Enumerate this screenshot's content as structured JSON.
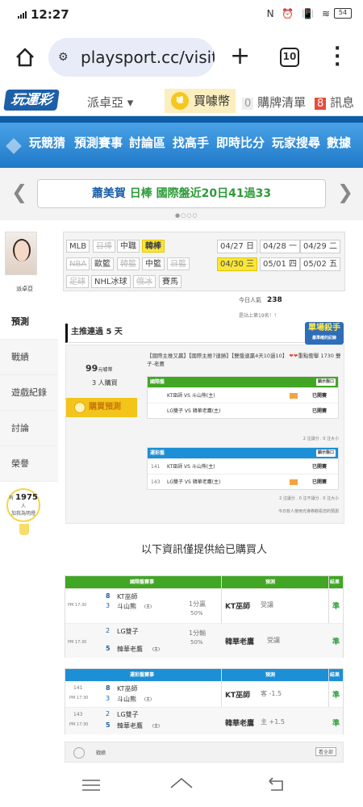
{
  "status": {
    "time": "12:27",
    "icons": "N ⏰ 📳 ≋",
    "battery": "54"
  },
  "browser": {
    "url": "playsport.cc/visit",
    "tab_count": "10"
  },
  "site": {
    "logo": "玩運彩",
    "user": "派卓亞",
    "buy_label": "買噱幣",
    "coin": "噱",
    "cart_count": "0",
    "cart_label": "購牌清單",
    "msg_count": "8",
    "msg_label": "訊息"
  },
  "nav": [
    "玩競猜",
    "預測賽事",
    "討論區",
    "找高手",
    "即時比分",
    "玩家搜尋",
    "數據"
  ],
  "ticker": {
    "name": "蕭美賀",
    "text": "日棒 國際盤近20日41過33",
    "name_color": "#1d5fa8",
    "text_color": "#2e9b3a"
  },
  "profile": {
    "name": "派卓亞",
    "menu": [
      "預測",
      "戰績",
      "遊戲紀錄",
      "討論",
      "榮譽"
    ],
    "fans_label": "有",
    "fans": "1975",
    "fans_unit": "人",
    "fans_sub": "加我為明燈"
  },
  "filters": {
    "leagues": [
      {
        "label": "MLB",
        "state": "normal"
      },
      {
        "label": "日棒",
        "state": "disabled"
      },
      {
        "label": "中職",
        "state": "normal"
      },
      {
        "label": "韓棒",
        "state": "selected"
      },
      {
        "label": "NBA",
        "state": "disabled"
      },
      {
        "label": "歐籃",
        "state": "normal"
      },
      {
        "label": "韓籃",
        "state": "disabled"
      },
      {
        "label": "中籃",
        "state": "normal"
      },
      {
        "label": "日籃",
        "state": "disabled"
      },
      {
        "label": "足球",
        "state": "disabled"
      },
      {
        "label": "NHL冰球",
        "state": "normal"
      },
      {
        "label": "俄冰",
        "state": "disabled"
      },
      {
        "label": "賽馬",
        "state": "normal"
      }
    ],
    "dates": [
      {
        "d": "04/27",
        "w": "日",
        "sel": false
      },
      {
        "d": "04/28",
        "w": "一",
        "sel": false
      },
      {
        "d": "04/29",
        "w": "二",
        "sel": false
      },
      {
        "d": "04/30",
        "w": "三",
        "sel": true
      },
      {
        "d": "05/01",
        "w": "四",
        "sel": false
      },
      {
        "d": "05/02",
        "w": "五",
        "sel": false
      }
    ]
  },
  "popularity": {
    "label": "今日人氣",
    "value": "238",
    "rank": "是站上第19名！！"
  },
  "rec": {
    "title": "主推連過 5 天",
    "badge_title": "單場殺手",
    "badge_sub": "最準確的記錄",
    "price": "99",
    "price_unit": "元噱幣",
    "buyers": "3",
    "buyers_label": "人購買",
    "buy_button": "購買預測",
    "note": "【國際主推又贏】【國際主推7連勝】【雙盤連贏4天10過10】",
    "note_hearts": "❤❤",
    "note_tail": "重點衝擊 1730 雙子-老鷹"
  },
  "intl": {
    "header": "國際盤",
    "action": "顯示盤口",
    "rows": [
      {
        "a": "",
        "b": "KT巫師 VS 斗山熊(主)",
        "r": "已開賽"
      },
      {
        "a": "",
        "b": "LG雙子 VS 韓華老鷹(主)",
        "r": "已開賽"
      }
    ],
    "foot": "2 注讓分 . 0 注大小"
  },
  "lottery": {
    "header": "運彩盤",
    "action": "顯示盤口",
    "rows": [
      {
        "a": "141",
        "b": "KT巫師 VS 斗山熊(主)",
        "r": "已開賽"
      },
      {
        "a": "143",
        "b": "LG雙子 VS 韓華老鷹(主)",
        "r": "已開賽"
      }
    ],
    "foot": "2 注讓分 . 0 注不讓分 . 0 注大小",
    "foot2": "今日有人使用光導券觀看您的預測"
  },
  "purchased_title": "以下資訊僅提供給已購買人",
  "intl_result": {
    "headers": [
      "國際盤賽事",
      "預測",
      "結果"
    ],
    "header_color": "#41a624",
    "rows": [
      {
        "time": "PM 17:30",
        "s1": "8",
        "t1": "KT巫師",
        "s2": "3",
        "t2": "斗山熊",
        "home": "(主)",
        "line": "1分贏",
        "pct": "50%",
        "pick": "KT巫師",
        "pick_note": "受讓",
        "result": "準"
      },
      {
        "time": "PM 17:30",
        "s1": "2",
        "t1": "LG雙子",
        "s2": "5",
        "t2": "韓華老鷹",
        "home": "(主)",
        "line": "1分輸",
        "pct": "50%",
        "pick": "韓華老鷹",
        "pick_note": "受讓",
        "result": "準"
      }
    ]
  },
  "lottery_result": {
    "headers": [
      "運彩盤賽事",
      "預測",
      "結果"
    ],
    "header_color": "#1d8fd6",
    "rows": [
      {
        "no": "141",
        "time": "PM 17:30",
        "s1": "8",
        "t1": "KT巫師",
        "s2": "3",
        "t2": "斗山熊",
        "home": "(主)",
        "pick": "KT巫師",
        "pick_note": "客 -1.5",
        "result": "準"
      },
      {
        "no": "143",
        "time": "PM 17:30",
        "s1": "2",
        "t1": "LG雙子",
        "s2": "5",
        "t2": "韓華老鷹",
        "home": "(主)",
        "pick": "韓華老鷹",
        "pick_note": "主 +1.5",
        "result": "準"
      }
    ]
  },
  "record": {
    "label": "戰績",
    "action": "看全部"
  }
}
